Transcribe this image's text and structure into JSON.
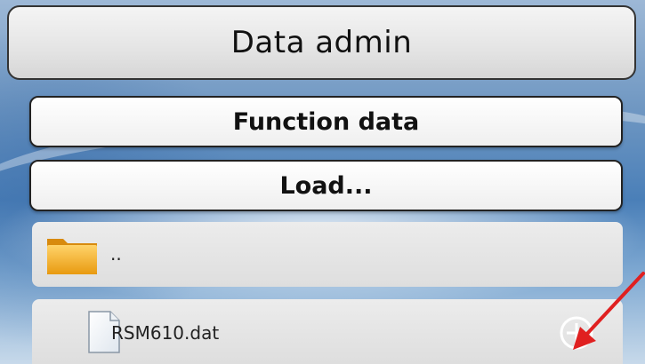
{
  "header": {
    "title": "Data admin"
  },
  "buttons": {
    "function_data": "Function data",
    "load": "Load..."
  },
  "file_list": [
    {
      "label": "..",
      "icon": "folder-icon",
      "type": "parent-folder"
    },
    {
      "label": "RSM610.dat",
      "icon": "file-icon",
      "type": "file",
      "action_icon": "add-circle-icon"
    }
  ],
  "colors": {
    "annotation_arrow": "#e02020",
    "folder": "#f2a818"
  }
}
